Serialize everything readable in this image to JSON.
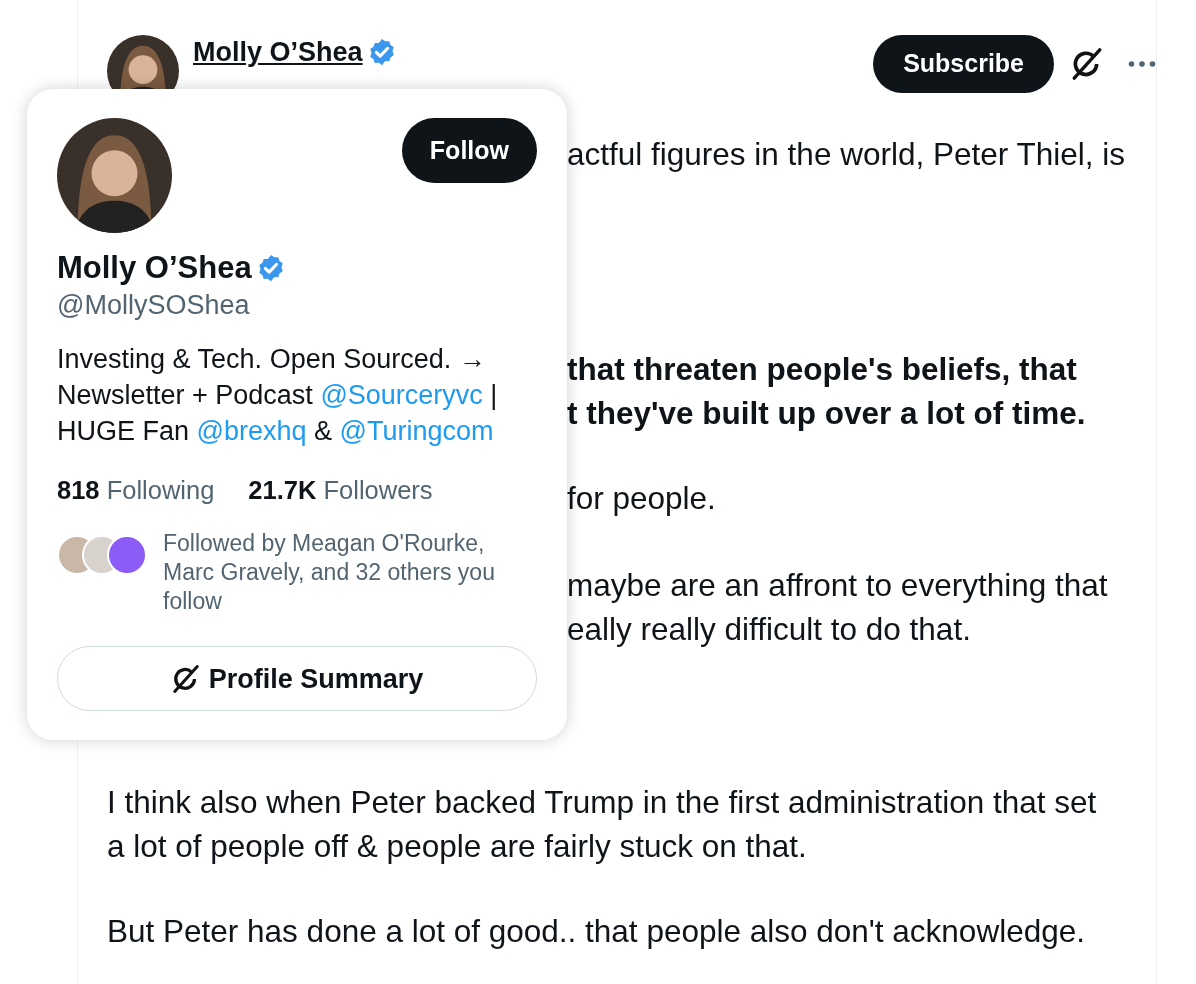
{
  "post_header": {
    "name": "Molly O’Shea",
    "verified": true,
    "subscribe_button": "Subscribe"
  },
  "post_body": [
    {
      "kind": "partial",
      "lines": [
        "actful figures in the world, Peter Thiel, is"
      ]
    },
    {
      "kind": "partial_bold",
      "lines": [
        "that threaten people's beliefs, that",
        "t they've built up over a lot of time."
      ]
    },
    {
      "kind": "partial",
      "lines": [
        "for people."
      ]
    },
    {
      "kind": "partial",
      "lines": [
        "maybe are an affront to everything that",
        "eally really difficult to do that."
      ]
    },
    {
      "kind": "full",
      "lines": [
        "I think also when Peter backed Trump in the first administration that set",
        "a lot of people off & people are fairly stuck on that."
      ]
    },
    {
      "kind": "full",
      "lines": [
        "But Peter has done a lot of good.. that people also don't acknowledge."
      ]
    }
  ],
  "hover_card": {
    "follow_button": "Follow",
    "name": "Molly O’Shea",
    "verified": true,
    "handle": "@MollySOShea",
    "bio_lines": [
      [
        {
          "kind": "text",
          "text": "Investing & Tech. Open Sourced. →"
        }
      ],
      [
        {
          "kind": "text",
          "text": "Newsletter + Podcast "
        },
        {
          "kind": "mention",
          "text": "@Sourceryvc"
        },
        {
          "kind": "text",
          "text": " |"
        }
      ],
      [
        {
          "kind": "text",
          "text": "HUGE Fan "
        },
        {
          "kind": "mention",
          "text": "@brexhq"
        },
        {
          "kind": "text",
          "text": " & "
        },
        {
          "kind": "mention",
          "text": "@Turingcom"
        }
      ]
    ],
    "stats": [
      {
        "count": "818",
        "label": "Following"
      },
      {
        "count": "21.7K",
        "label": "Followers"
      }
    ],
    "followed_by": "Followed by Meagan O'Rourke, Marc Gravely, and 32 others you follow",
    "follower_avatars": [
      {
        "color": "#c9b8a8"
      },
      {
        "color": "#d8d2cc"
      },
      {
        "color": "#8b5cf6"
      }
    ],
    "summary_button": "Profile Summary"
  }
}
